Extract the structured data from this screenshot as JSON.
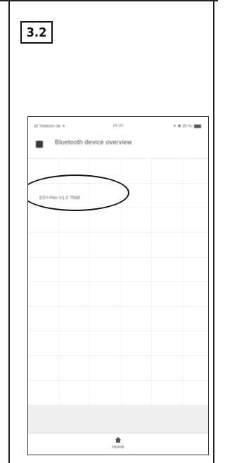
{
  "step": {
    "label": "3.2"
  },
  "phone": {
    "status_bar": {
      "carrier": "all Telekom.de ✈",
      "time": "14:20",
      "battery": "✈ ✱ 30 %"
    },
    "header": {
      "back_icon": "back-icon",
      "title": "Bluetooth device overview"
    },
    "devices": [
      {
        "name": "ESY-Pen V1.0 7588",
        "highlighted": true
      }
    ],
    "tabbar": {
      "home_icon": "home-icon",
      "home_label": "Home"
    }
  },
  "colors": {
    "frame": "#222222",
    "highlight": "#111111"
  }
}
